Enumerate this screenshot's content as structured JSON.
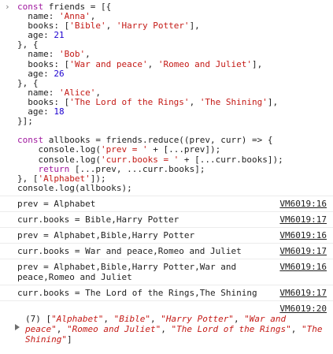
{
  "console": {
    "prompt_glyph": "›",
    "input_lines": [
      [
        [
          "kw",
          "const"
        ],
        [
          "t",
          " friends = [{"
        ]
      ],
      [
        [
          "t",
          "  name: "
        ],
        [
          "s",
          "'Anna'"
        ],
        [
          "t",
          ","
        ]
      ],
      [
        [
          "t",
          "  books: ["
        ],
        [
          "s",
          "'Bible'"
        ],
        [
          "t",
          ", "
        ],
        [
          "s",
          "'Harry Potter'"
        ],
        [
          "t",
          "],"
        ]
      ],
      [
        [
          "t",
          "  age: "
        ],
        [
          "n",
          "21"
        ]
      ],
      [
        [
          "t",
          "}, {"
        ]
      ],
      [
        [
          "t",
          "  name: "
        ],
        [
          "s",
          "'Bob'"
        ],
        [
          "t",
          ","
        ]
      ],
      [
        [
          "t",
          "  books: ["
        ],
        [
          "s",
          "'War and peace'"
        ],
        [
          "t",
          ", "
        ],
        [
          "s",
          "'Romeo and Juliet'"
        ],
        [
          "t",
          "],"
        ]
      ],
      [
        [
          "t",
          "  age: "
        ],
        [
          "n",
          "26"
        ]
      ],
      [
        [
          "t",
          "}, {"
        ]
      ],
      [
        [
          "t",
          "  name: "
        ],
        [
          "s",
          "'Alice'"
        ],
        [
          "t",
          ","
        ]
      ],
      [
        [
          "t",
          "  books: ["
        ],
        [
          "s",
          "'The Lord of the Rings'"
        ],
        [
          "t",
          ", "
        ],
        [
          "s",
          "'The Shining'"
        ],
        [
          "t",
          "],"
        ]
      ],
      [
        [
          "t",
          "  age: "
        ],
        [
          "n",
          "18"
        ]
      ],
      [
        [
          "t",
          "}];"
        ]
      ],
      [
        [
          "t",
          ""
        ]
      ],
      [
        [
          "kw",
          "const"
        ],
        [
          "t",
          " allbooks = friends.reduce((prev, curr) => {"
        ]
      ],
      [
        [
          "t",
          "    console.log("
        ],
        [
          "s",
          "'prev = '"
        ],
        [
          "t",
          " + [...prev]);"
        ]
      ],
      [
        [
          "t",
          "    console.log("
        ],
        [
          "s",
          "'curr.books = '"
        ],
        [
          "t",
          " + [...curr.books]);"
        ]
      ],
      [
        [
          "t",
          "    "
        ],
        [
          "kw",
          "return"
        ],
        [
          "t",
          " [...prev, ...curr.books];"
        ]
      ],
      [
        [
          "t",
          "}, ["
        ],
        [
          "s",
          "'Alphabet'"
        ],
        [
          "t",
          "]);"
        ]
      ],
      [
        [
          "t",
          "console.log(allbooks);"
        ]
      ]
    ],
    "logs": [
      {
        "text": "prev = Alphabet",
        "source": "VM6019:16"
      },
      {
        "text": "curr.books = Bible,Harry Potter",
        "source": "VM6019:17"
      },
      {
        "text": "prev = Alphabet,Bible,Harry Potter",
        "source": "VM6019:16"
      },
      {
        "text": "curr.books = War and peace,Romeo and Juliet",
        "source": "VM6019:17"
      },
      {
        "text": "prev = Alphabet,Bible,Harry Potter,War and peace,Romeo and Juliet",
        "source": "VM6019:16"
      },
      {
        "text": "curr.books = The Lord of the Rings,The Shining",
        "source": "VM6019:17"
      }
    ],
    "result": {
      "source": "VM6019:20",
      "length_label": "(7)",
      "items": [
        "\"Alphabet\"",
        "\"Bible\"",
        "\"Harry Potter\"",
        "\"War and peace\"",
        "\"Romeo and Juliet\"",
        "\"The Lord of the Rings\"",
        "\"The Shining\""
      ]
    }
  }
}
